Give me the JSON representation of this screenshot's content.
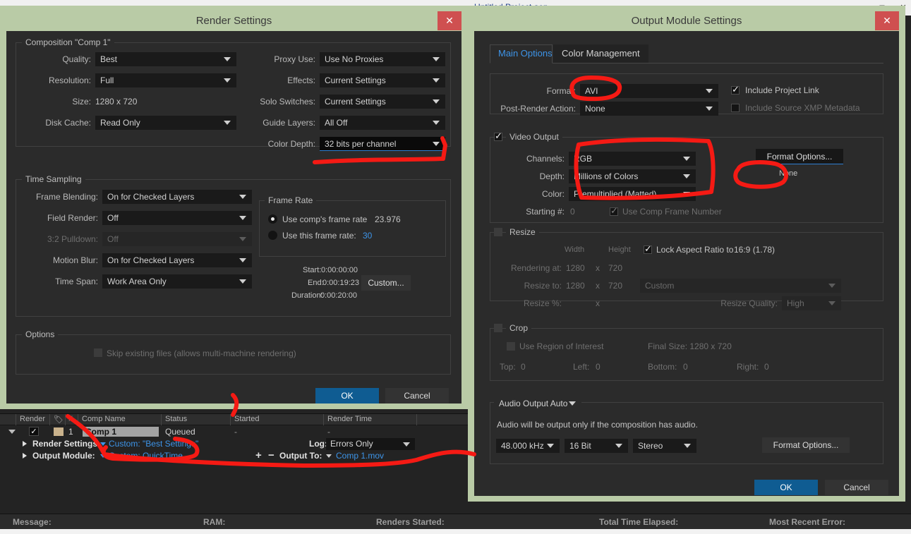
{
  "app": {
    "window_title": "Untitled Project.aep",
    "minimize_icon": "minimize-icon",
    "maximize_icon": "maximize-icon",
    "close_icon": "close-icon"
  },
  "render_settings": {
    "title": "Render Settings",
    "close_label": "✕",
    "composition": {
      "group_title": "Composition \"Comp 1\"",
      "quality_label": "Quality:",
      "quality_value": "Best",
      "resolution_label": "Resolution:",
      "resolution_value": "Full",
      "size_label": "Size:",
      "size_value": "1280 x 720",
      "disk_cache_label": "Disk Cache:",
      "disk_cache_value": "Read Only",
      "proxy_use_label": "Proxy Use:",
      "proxy_use_value": "Use No Proxies",
      "effects_label": "Effects:",
      "effects_value": "Current Settings",
      "solo_switches_label": "Solo Switches:",
      "solo_switches_value": "Current Settings",
      "guide_layers_label": "Guide Layers:",
      "guide_layers_value": "All Off",
      "color_depth_label": "Color Depth:",
      "color_depth_value": "32 bits per channel"
    },
    "time_sampling": {
      "group_title": "Time Sampling",
      "frame_blending_label": "Frame Blending:",
      "frame_blending_value": "On for Checked Layers",
      "field_render_label": "Field Render:",
      "field_render_value": "Off",
      "pulldown_label": "3:2 Pulldown:",
      "pulldown_value": "Off",
      "motion_blur_label": "Motion Blur:",
      "motion_blur_value": "On for Checked Layers",
      "time_span_label": "Time Span:",
      "time_span_value": "Work Area Only",
      "frame_rate": {
        "group_title": "Frame Rate",
        "use_comp_label": "Use comp's frame rate",
        "use_comp_value": "23.976",
        "use_this_label": "Use this frame rate:",
        "use_this_value": "30"
      },
      "start_label": "Start:",
      "start_value": "0:00:00:00",
      "end_label": "End:",
      "end_value": "0:00:19:23",
      "duration_label": "Duration:",
      "duration_value": "0:00:20:00",
      "custom_button": "Custom..."
    },
    "options": {
      "group_title": "Options",
      "skip_existing_label": "Skip existing files (allows multi-machine rendering)"
    },
    "ok_label": "OK",
    "cancel_label": "Cancel"
  },
  "output_module": {
    "title": "Output Module Settings",
    "close_label": "✕",
    "tabs": [
      {
        "label": "Main Options",
        "active": true
      },
      {
        "label": "Color Management",
        "active": false
      }
    ],
    "format_label": "Format:",
    "format_value": "AVI",
    "post_render_label": "Post-Render Action:",
    "post_render_value": "None",
    "include_project_link_label": "Include Project Link",
    "include_xmp_label": "Include Source XMP Metadata",
    "video_output": {
      "group_title": "Video Output",
      "channels_label": "Channels:",
      "channels_value": "RGB",
      "depth_label": "Depth:",
      "depth_value": "Millions of Colors",
      "color_label": "Color:",
      "color_value": "Premultiplied (Matted)",
      "starting_label": "Starting #:",
      "starting_value": "0",
      "use_comp_frame_number_label": "Use Comp Frame Number",
      "format_options_button": "Format Options...",
      "format_options_status": "None"
    },
    "resize": {
      "group_title": "Resize",
      "width_header": "Width",
      "height_header": "Height",
      "lock_aspect_label": "Lock Aspect Ratio to",
      "lock_aspect_value": "16:9 (1.78)",
      "rendering_at_label": "Rendering at:",
      "rendering_at_width": "1280",
      "rendering_at_x": "x",
      "rendering_at_height": "720",
      "resize_to_label": "Resize to:",
      "resize_to_width": "1280",
      "resize_to_x": "x",
      "resize_to_height": "720",
      "resize_preset": "Custom",
      "resize_pct_label": "Resize %:",
      "resize_pct_x": "x",
      "resize_quality_label": "Resize Quality:",
      "resize_quality_value": "High"
    },
    "crop": {
      "group_title": "Crop",
      "use_roi_label": "Use Region of Interest",
      "final_size_label": "Final Size: 1280 x 720",
      "top_label": "Top:",
      "top_value": "0",
      "left_label": "Left:",
      "left_value": "0",
      "bottom_label": "Bottom:",
      "bottom_value": "0",
      "right_label": "Right:",
      "right_value": "0"
    },
    "audio": {
      "output_mode": "Audio Output Auto",
      "note": "Audio will be output only if the composition has audio.",
      "sample_rate": "48.000 kHz",
      "bit_depth": "16 Bit",
      "channels": "Stereo",
      "format_options_button": "Format Options..."
    },
    "ok_label": "OK",
    "cancel_label": "Cancel"
  },
  "render_queue": {
    "headers": [
      "Render",
      "tag-icon",
      "#",
      "Comp Name",
      "Status",
      "Started",
      "Render Time"
    ],
    "header_render": "Render",
    "header_hash": "#",
    "header_comp_name": "Comp Name",
    "header_status": "Status",
    "header_started": "Started",
    "header_render_time": "Render Time",
    "row": {
      "index": "1",
      "comp_name": "Comp 1",
      "status": "Queued",
      "started": "-",
      "render_time": "-"
    },
    "render_settings_label": "Render Settings:",
    "render_settings_value": "Custom: \"Best Settings\"",
    "output_module_label": "Output Module:",
    "output_module_value": "Custom: QuickTime",
    "log_label": "Log:",
    "log_value": "Errors Only",
    "output_to_label": "Output To:",
    "output_to_value": "Comp 1.mov",
    "add_label": "+",
    "remove_label": "−"
  },
  "status_bar": {
    "message_label": "Message:",
    "ram_label": "RAM:",
    "renders_started_label": "Renders Started:",
    "total_time_label": "Total Time Elapsed:",
    "most_recent_error_label": "Most Recent Error:"
  },
  "colors": {
    "dialog_chrome": "#b9cba6",
    "dialog_body": "#2b2b2b",
    "accent_blue": "#3d94e8",
    "primary_button": "#0f5c92",
    "close_red": "#cf5050",
    "annotation_red": "#f51a14"
  }
}
